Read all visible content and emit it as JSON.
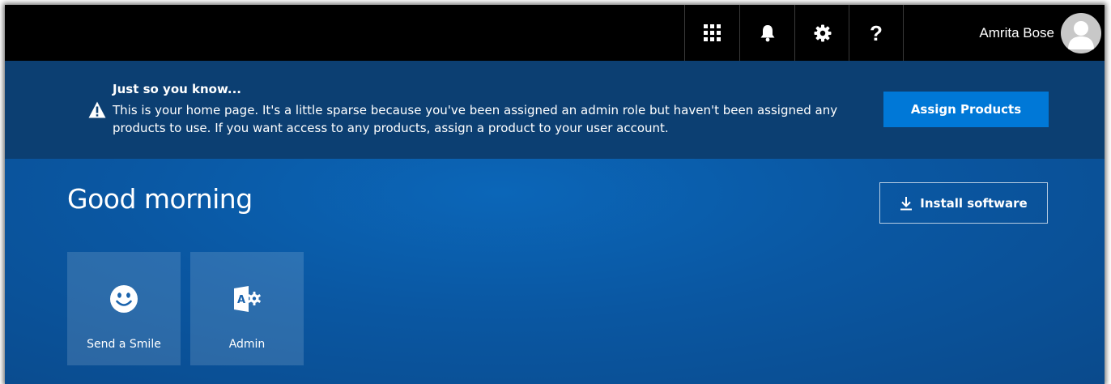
{
  "topbar": {
    "icons": [
      "app-launcher-icon",
      "bell-icon",
      "gear-icon",
      "help-icon"
    ],
    "help_glyph": "?",
    "user_name": "Amrita Bose"
  },
  "notice": {
    "title": "Just so you know...",
    "body": "This is your home page. It's a little sparse because you've been assigned an admin role but haven't been assigned any products to use. If you want access to any products, assign a product to your user account.",
    "button_label": "Assign Products",
    "icon": "warning-icon"
  },
  "main": {
    "greeting": "Good morning",
    "install_label": "Install software",
    "tiles": [
      {
        "label": "Send a Smile",
        "icon": "smiley-icon"
      },
      {
        "label": "Admin",
        "icon": "admin-icon"
      }
    ]
  },
  "colors": {
    "topbar": "#000000",
    "notice_bg": "#0c3f72",
    "main_bg": "#0a57a2",
    "accent": "#0078d7"
  }
}
